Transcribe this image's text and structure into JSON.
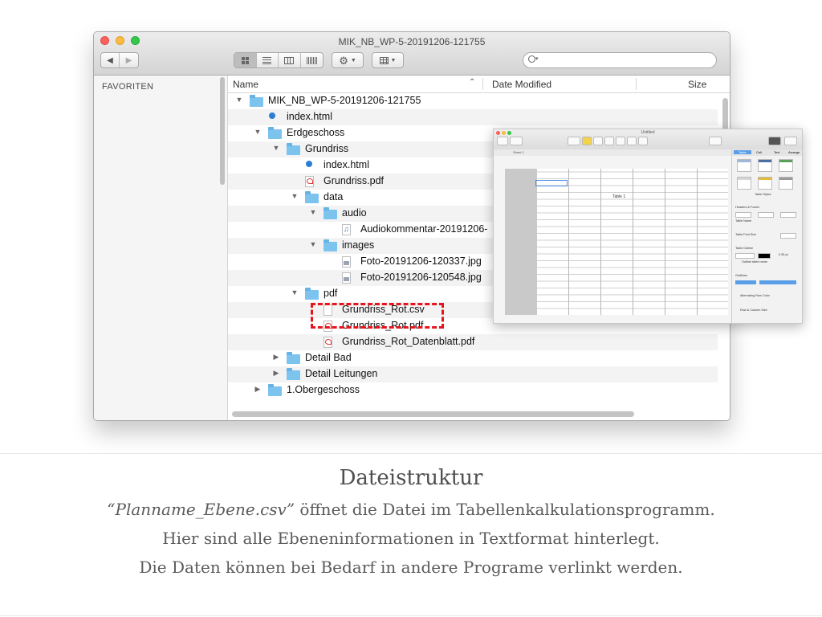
{
  "window": {
    "title": "MIK_NB_WP-5-20191206-121755",
    "toolbar": {
      "back": "◀",
      "forward": "▶",
      "search_placeholder": ""
    }
  },
  "sidebar": {
    "header": "FAVORITEN"
  },
  "columns": {
    "name": "Name",
    "date_modified": "Date Modified",
    "size": "Size",
    "sort_indicator": "⌃"
  },
  "rows": [
    {
      "name": "MIK_NB_WP-5-20191206-121755",
      "icon": "folder-icon",
      "indent": 0,
      "disclosure": "▼"
    },
    {
      "name": "index.html",
      "icon": "html-icon",
      "indent": 1,
      "disclosure": ""
    },
    {
      "name": "Erdgeschoss",
      "icon": "folder-icon",
      "indent": 1,
      "disclosure": "▼"
    },
    {
      "name": "Grundriss",
      "icon": "folder-icon",
      "indent": 2,
      "disclosure": "▼"
    },
    {
      "name": "index.html",
      "icon": "html-icon",
      "indent": 3,
      "disclosure": ""
    },
    {
      "name": "Grundriss.pdf",
      "icon": "pdf-icon",
      "indent": 3,
      "disclosure": ""
    },
    {
      "name": "data",
      "icon": "folder-icon",
      "indent": 3,
      "disclosure": "▼"
    },
    {
      "name": "audio",
      "icon": "folder-icon",
      "indent": 4,
      "disclosure": "▼"
    },
    {
      "name": "Audiokommentar-20191206-",
      "icon": "audio-icon",
      "indent": 5,
      "disclosure": ""
    },
    {
      "name": "images",
      "icon": "folder-icon",
      "indent": 4,
      "disclosure": "▼"
    },
    {
      "name": "Foto-20191206-120337.jpg",
      "icon": "image-icon",
      "indent": 5,
      "disclosure": ""
    },
    {
      "name": "Foto-20191206-120548.jpg",
      "icon": "image-icon",
      "indent": 5,
      "disclosure": ""
    },
    {
      "name": "pdf",
      "icon": "folder-icon",
      "indent": 3,
      "disclosure": "▼"
    },
    {
      "name": "Grundriss_Rot.csv",
      "icon": "doc-icon",
      "indent": 4,
      "disclosure": ""
    },
    {
      "name": "Grundriss_Rot.pdf",
      "icon": "pdf-icon",
      "indent": 4,
      "disclosure": ""
    },
    {
      "name": "Grundriss_Rot_Datenblatt.pdf",
      "icon": "pdf-icon",
      "indent": 4,
      "disclosure": ""
    },
    {
      "name": "Detail Bad",
      "icon": "folder-icon",
      "indent": 2,
      "disclosure": "▶"
    },
    {
      "name": "Detail Leitungen",
      "icon": "folder-icon",
      "indent": 2,
      "disclosure": "▶"
    },
    {
      "name": "1.Obergeschoss",
      "icon": "folder-icon",
      "indent": 1,
      "disclosure": "▶"
    }
  ],
  "numbers_overlay": {
    "window_title": "Untitled",
    "sheet_tab": "Sheet 1",
    "table_title": "Table 1",
    "panel_tabs": [
      "Table",
      "Cell",
      "Text",
      "Arrange"
    ],
    "panel_labels": [
      "Table Styles",
      "Headers & Footer",
      "Table Name",
      "Table Font Size",
      "Table Outline",
      "Outline table name",
      "Gridlines",
      "Alternating Row Color",
      "Row & Column Size"
    ],
    "outline_value": "0.35 pt"
  },
  "caption": {
    "heading": "Dateistruktur",
    "line1_italic": "“Planname_Ebene.csv”",
    "line1_rest": " öffnet die Datei im Tabellenkalkulationsprogramm.",
    "line2": "Hier sind alle Ebeneninformationen in Textformat hinterlegt.",
    "line3": "Die Daten können bei Bedarf in andere Programe verlinkt werden."
  },
  "colors": {
    "highlight": "#e8141c",
    "folder": "#7cc3ee"
  }
}
